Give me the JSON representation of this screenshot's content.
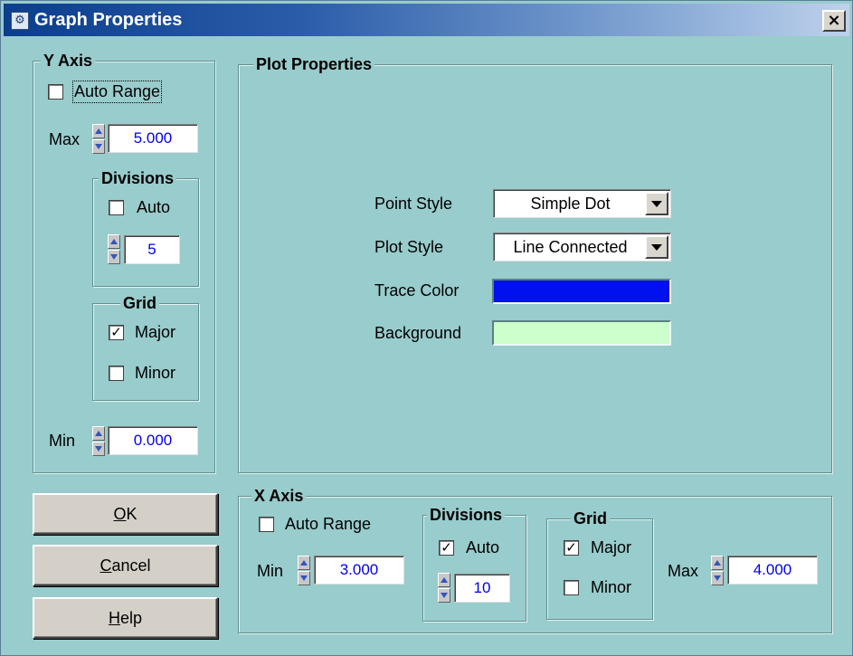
{
  "window": {
    "title": "Graph Properties",
    "close_label": "×"
  },
  "y_axis": {
    "title": "Y Axis",
    "auto_range_label": "Auto Range",
    "auto_range_checked": false,
    "max_label": "Max",
    "max_value": "5.000",
    "divisions": {
      "title": "Divisions",
      "auto_label": "Auto",
      "auto_checked": false,
      "value": "5"
    },
    "grid": {
      "title": "Grid",
      "major_label": "Major",
      "major_checked": true,
      "minor_label": "Minor",
      "minor_checked": false
    },
    "min_label": "Min",
    "min_value": "0.000"
  },
  "plot_properties": {
    "title": "Plot Properties",
    "point_style_label": "Point Style",
    "point_style_value": "Simple Dot",
    "plot_style_label": "Plot Style",
    "plot_style_value": "Line Connected",
    "trace_color_label": "Trace Color",
    "trace_color": "#0010ee",
    "background_label": "Background",
    "background_color": "#ccffcc"
  },
  "x_axis": {
    "title": "X Axis",
    "auto_range_label": "Auto Range",
    "auto_range_checked": false,
    "min_label": "Min",
    "min_value": "3.000",
    "divisions": {
      "title": "Divisions",
      "auto_label": "Auto",
      "auto_checked": true,
      "value": "10"
    },
    "grid": {
      "title": "Grid",
      "major_label": "Major",
      "major_checked": true,
      "minor_label": "Minor",
      "minor_checked": false
    },
    "max_label": "Max",
    "max_value": "4.000"
  },
  "buttons": {
    "ok": {
      "mnemonic": "O",
      "rest": "K"
    },
    "cancel": {
      "mnemonic": "C",
      "rest": "ancel"
    },
    "help": {
      "mnemonic": "H",
      "rest": "elp"
    }
  },
  "check_glyph": "✓"
}
